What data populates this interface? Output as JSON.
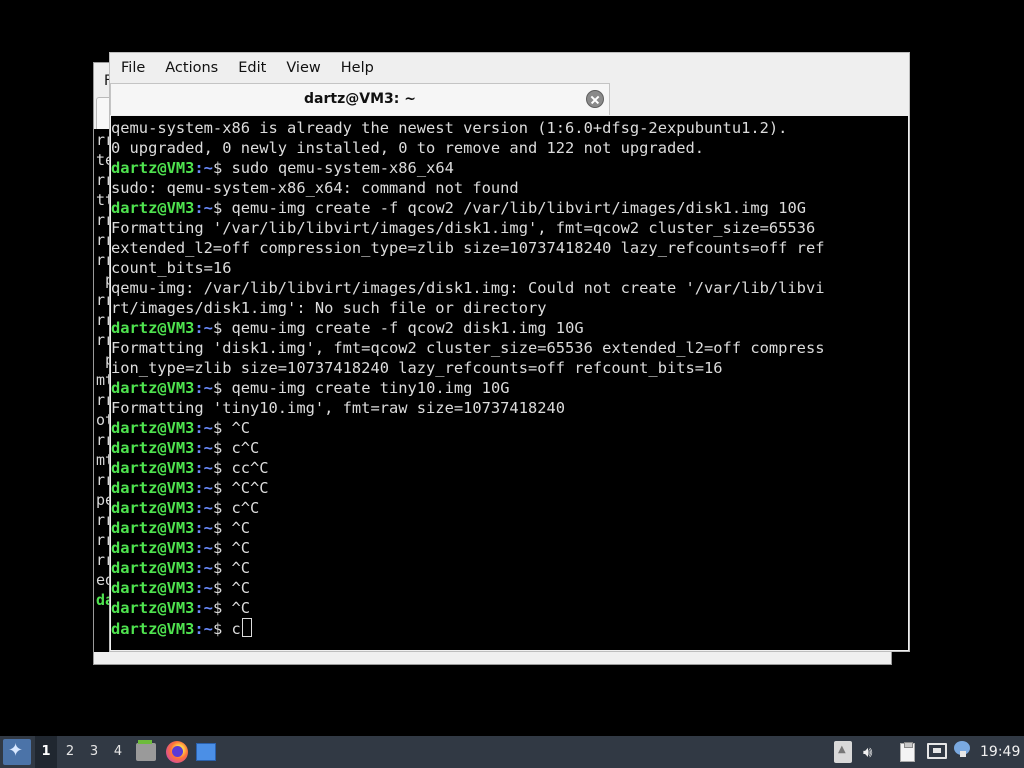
{
  "background_window": {
    "menu_first_letter": "F",
    "visible_line_fragments": [
      "rr",
      "te",
      "rr",
      "tt",
      "rr",
      "rr",
      "rr",
      " p",
      "rr",
      "rr",
      "rr",
      " p",
      "mt",
      "rr",
      "ot",
      "rr",
      "mt",
      "rr",
      "pe",
      "rr",
      "rr",
      "rr",
      "ed",
      "da"
    ]
  },
  "window": {
    "menu": [
      "File",
      "Actions",
      "Edit",
      "View",
      "Help"
    ],
    "tab_title": "dartz@VM3: ~",
    "prompt_user": "dartz@VM3",
    "prompt_path": ":~",
    "prompt_symbol": "$ "
  },
  "terminal": {
    "lines": [
      {
        "type": "output",
        "text": "qemu-system-x86 is already the newest version (1:6.0+dfsg-2expubuntu1.2)."
      },
      {
        "type": "output",
        "text": "0 upgraded, 0 newly installed, 0 to remove and 122 not upgraded."
      },
      {
        "type": "prompt",
        "text": "sudo qemu-system-x86_x64"
      },
      {
        "type": "output",
        "text": "sudo: qemu-system-x86_x64: command not found"
      },
      {
        "type": "prompt",
        "text": "qemu-img create -f qcow2 /var/lib/libvirt/images/disk1.img 10G"
      },
      {
        "type": "output",
        "text": "Formatting '/var/lib/libvirt/images/disk1.img', fmt=qcow2 cluster_size=65536"
      },
      {
        "type": "output",
        "text": "extended_l2=off compression_type=zlib size=10737418240 lazy_refcounts=off ref"
      },
      {
        "type": "output",
        "text": "count_bits=16"
      },
      {
        "type": "output",
        "text": "qemu-img: /var/lib/libvirt/images/disk1.img: Could not create '/var/lib/libvi"
      },
      {
        "type": "output",
        "text": "rt/images/disk1.img': No such file or directory"
      },
      {
        "type": "prompt",
        "text": "qemu-img create -f qcow2 disk1.img 10G"
      },
      {
        "type": "output",
        "text": "Formatting 'disk1.img', fmt=qcow2 cluster_size=65536 extended_l2=off compress"
      },
      {
        "type": "output",
        "text": "ion_type=zlib size=10737418240 lazy_refcounts=off refcount_bits=16"
      },
      {
        "type": "prompt",
        "text": "qemu-img create tiny10.img 10G"
      },
      {
        "type": "output",
        "text": "Formatting 'tiny10.img', fmt=raw size=10737418240"
      },
      {
        "type": "prompt",
        "text": "^C"
      },
      {
        "type": "prompt",
        "text": "c^C"
      },
      {
        "type": "prompt",
        "text": "cc^C"
      },
      {
        "type": "prompt",
        "text": "^C^C"
      },
      {
        "type": "prompt",
        "text": "c^C"
      },
      {
        "type": "prompt",
        "text": "^C"
      },
      {
        "type": "prompt",
        "text": "^C"
      },
      {
        "type": "prompt",
        "text": "^C"
      },
      {
        "type": "prompt",
        "text": "^C"
      },
      {
        "type": "prompt",
        "text": "^C"
      },
      {
        "type": "prompt",
        "text": "c",
        "cursor": true
      }
    ]
  },
  "taskbar": {
    "workspaces": [
      "1",
      "2",
      "3",
      "4"
    ],
    "active_workspace": "1",
    "launchers": [
      "file-manager-icon",
      "firefox-icon",
      "show-desktop-icon"
    ],
    "tray": [
      "scroll-indicator-icon",
      "volume-icon",
      "clipboard-icon",
      "network-icon",
      "updates-icon"
    ],
    "clock": "19:49"
  },
  "colors": {
    "prompt_user": "#4fe34f",
    "prompt_path": "#6b8cff",
    "terminal_text": "#dcdcdc",
    "taskbar_bg": "#313944"
  }
}
